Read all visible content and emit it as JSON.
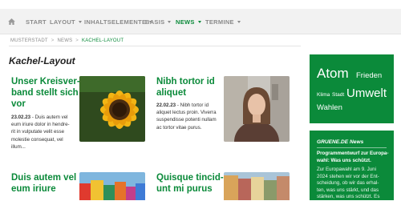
{
  "nav": {
    "items": [
      {
        "label": "START"
      },
      {
        "label": "LAYOUT"
      },
      {
        "label": "INHALTSELEMENTE"
      },
      {
        "label": "BASIS"
      },
      {
        "label": "NEWS"
      },
      {
        "label": "TERMINE"
      }
    ]
  },
  "breadcrumb": {
    "items": [
      "MUSTERSTADT",
      "NEWS",
      "KACHEL-LAYOUT"
    ],
    "separator": ">"
  },
  "page": {
    "title": "Kachel-Layout"
  },
  "cards": [
    {
      "title_lines": [
        "Unser Kreisver-",
        "band stellt sich",
        "vor"
      ],
      "date": "23.02.23",
      "text_lines": [
        "- Duis autem vel",
        "eum iriure dolor in hendre-",
        "rit in vulputate velit esse",
        "molestie consequat, vel",
        "illum..."
      ]
    },
    {
      "title_lines": [
        "Nibh tortor id",
        "aliquet"
      ],
      "date": "22.02.23",
      "text_lines": [
        "- Nibh tortor id",
        "aliquet lectus proin. Viverra",
        "suspendisse potenti nullam",
        "ac tortor vitae purus."
      ]
    },
    {
      "title_lines": [
        "Duis autem vel",
        "eum iriure"
      ]
    },
    {
      "title_lines": [
        "Quisque tincid-",
        "unt mi purus"
      ]
    }
  ],
  "tag_cloud": {
    "tags": [
      "Atom",
      "Frieden",
      "Klima",
      "Stadt",
      "Umwelt",
      "Wahlen"
    ]
  },
  "news_widget": {
    "heading": "GRUENE.DE News",
    "title_lines": [
      "Programmentwurf zur Europa-",
      "wahl: Was uns schützt."
    ],
    "text_lines": [
      "Zur Europawahl am 9. Juni",
      "2024 stehen wir vor der Ent-",
      "scheidung, ob wir das erhal-",
      "ten, was uns stärkt, und das",
      "stärken, was uns schützt. Es"
    ]
  },
  "colors": {
    "accent": "#0b8a3a",
    "nav_bg": "#f2f2f2"
  }
}
